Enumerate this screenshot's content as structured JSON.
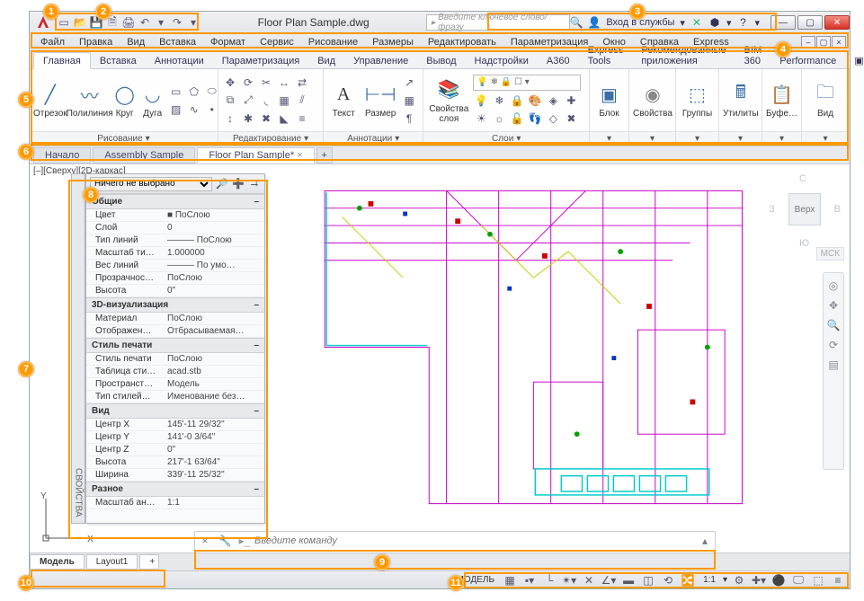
{
  "title": "Floor Plan Sample.dwg",
  "search_placeholder": "Введите ключевое слово/фразу",
  "signin": "Вход в службы",
  "menus": [
    "Файл",
    "Правка",
    "Вид",
    "Вставка",
    "Формат",
    "Сервис",
    "Рисование",
    "Размеры",
    "Редактировать",
    "Параметризация",
    "Окно",
    "Справка",
    "Express"
  ],
  "ribbon_tabs": [
    "Главная",
    "Вставка",
    "Аннотации",
    "Параметризация",
    "Вид",
    "Управление",
    "Вывод",
    "Надстройки",
    "A360",
    "Express Tools",
    "Рекомендованные приложения",
    "BIM 360",
    "Performance"
  ],
  "ribbon": {
    "draw": {
      "label": "Рисование",
      "btns": [
        "Отрезок",
        "Полилиния",
        "Круг",
        "Дуга"
      ]
    },
    "modify": {
      "label": "Редактирование"
    },
    "annot": {
      "label": "Аннотации",
      "btns": [
        "Текст",
        "Размер"
      ]
    },
    "layers": {
      "label": "Слои",
      "btn": "Свойства\nслоя"
    },
    "block": {
      "label": "Блок"
    },
    "props": {
      "label": "Свойства"
    },
    "groups": {
      "label": "Группы"
    },
    "utils": {
      "label": "Утилиты"
    },
    "clip": {
      "label": "Буфе…"
    },
    "view": {
      "label": "Вид"
    }
  },
  "file_tabs": [
    {
      "label": "Начало",
      "active": false
    },
    {
      "label": "Assembly Sample",
      "active": false
    },
    {
      "label": "Floor Plan Sample*",
      "active": true
    }
  ],
  "view_tag": "[–][Сверху][2D-каркас]",
  "viewcube": {
    "top": "Верх",
    "n": "С",
    "s": "Ю",
    "e": "В",
    "w": "З",
    "wcs": "МСК"
  },
  "properties": {
    "selector": "Ничего не выбрано",
    "groups": [
      {
        "name": "Общие",
        "rows": [
          {
            "k": "Цвет",
            "v": "■ ПоСлою"
          },
          {
            "k": "Слой",
            "v": "0"
          },
          {
            "k": "Тип линий",
            "v": "——— ПоСлою"
          },
          {
            "k": "Масштаб ти…",
            "v": "1.000000"
          },
          {
            "k": "Вес линий",
            "v": "——— По умо…"
          },
          {
            "k": "Прозрачнос…",
            "v": "ПоСлою"
          },
          {
            "k": "Высота",
            "v": "0\""
          }
        ]
      },
      {
        "name": "3D-визуализация",
        "rows": [
          {
            "k": "Материал",
            "v": "ПоСлою"
          },
          {
            "k": "Отображен…",
            "v": "Отбрасываемая…"
          }
        ]
      },
      {
        "name": "Стиль печати",
        "rows": [
          {
            "k": "Стиль печати",
            "v": "ПоСлою"
          },
          {
            "k": "Таблица сти…",
            "v": "acad.stb"
          },
          {
            "k": "Пространст…",
            "v": "Модель"
          },
          {
            "k": "Тип стилей…",
            "v": "Именование без…"
          }
        ]
      },
      {
        "name": "Вид",
        "rows": [
          {
            "k": "Центр X",
            "v": "145'-11 29/32\""
          },
          {
            "k": "Центр Y",
            "v": "141'-0 3/64\""
          },
          {
            "k": "Центр Z",
            "v": "0\""
          },
          {
            "k": "Высота",
            "v": "217'-1 63/64\""
          },
          {
            "k": "Ширина",
            "v": "339'-11 25/32\""
          }
        ]
      },
      {
        "name": "Разное",
        "rows": [
          {
            "k": "Масштаб ан…",
            "v": "1:1"
          }
        ]
      }
    ],
    "strip": "СВОЙСТВА"
  },
  "command_placeholder": "Введите команду",
  "layout_tabs": [
    {
      "label": "Модель",
      "active": true
    },
    {
      "label": "Layout1",
      "active": false
    }
  ],
  "status": {
    "model": "МОДЕЛЬ",
    "scale": "1:1"
  },
  "callouts": {
    "1": "1",
    "2": "2",
    "3": "3",
    "4": "4",
    "5": "5",
    "6": "6",
    "7": "7",
    "8": "8",
    "9": "9",
    "10": "10",
    "11": "11"
  }
}
